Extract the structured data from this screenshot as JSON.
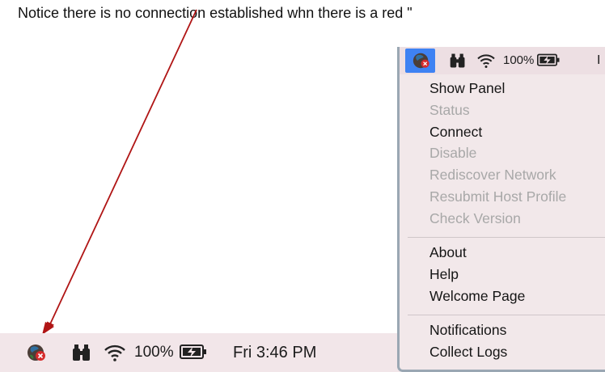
{
  "caption": "Notice there is no connection established whn there is a red \"",
  "menubar": {
    "battery_percent": "100%",
    "clock": "Fri 3:46 PM"
  },
  "popup": {
    "battery_percent": "100%",
    "partial_text": "I",
    "selected_color": "#3e82f3",
    "menu_items": [
      {
        "label": "Show Panel",
        "enabled": true
      },
      {
        "label": "Status",
        "enabled": false
      },
      {
        "label": "Connect",
        "enabled": true
      },
      {
        "label": "Disable",
        "enabled": false
      },
      {
        "label": "Rediscover Network",
        "enabled": false
      },
      {
        "label": "Resubmit Host Profile",
        "enabled": false
      },
      {
        "label": "Check Version",
        "enabled": false
      },
      {
        "label": "About",
        "enabled": true
      },
      {
        "label": "Help",
        "enabled": true
      },
      {
        "label": "Welcome Page",
        "enabled": true
      },
      {
        "label": "Notifications",
        "enabled": true
      },
      {
        "label": "Collect Logs",
        "enabled": true
      }
    ]
  },
  "icons": {
    "status_globe": "globe-disconnected-icon",
    "binoculars": "binoculars-icon",
    "wifi": "wifi-icon",
    "battery": "battery-charging-icon"
  },
  "annotation": {
    "arrow_color": "#b01515"
  }
}
